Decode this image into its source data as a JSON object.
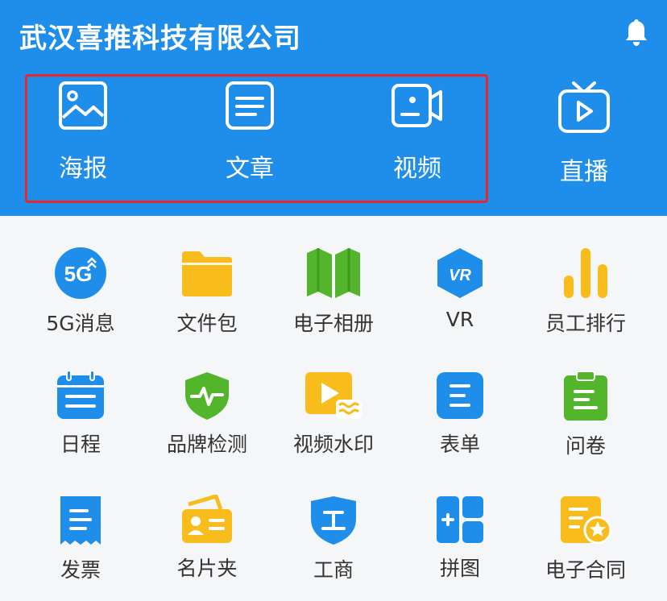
{
  "header": {
    "title": "武汉喜推科技有限公司"
  },
  "quick": [
    {
      "label": "海报",
      "icon": "image-icon"
    },
    {
      "label": "文章",
      "icon": "article-icon"
    },
    {
      "label": "视频",
      "icon": "video-camera-icon"
    },
    {
      "label": "直播",
      "icon": "tv-play-icon"
    }
  ],
  "grid": [
    {
      "label": "5G消息",
      "icon": "5g-icon",
      "color": "#1e8eea"
    },
    {
      "label": "文件包",
      "icon": "folder-icon",
      "color": "#f8bd1c"
    },
    {
      "label": "电子相册",
      "icon": "book-icon",
      "color": "#52b52b"
    },
    {
      "label": "VR",
      "icon": "vr-icon",
      "color": "#1e8eea"
    },
    {
      "label": "员工排行",
      "icon": "bar-chart-icon",
      "color": "#f8bd1c"
    },
    {
      "label": "日程",
      "icon": "calendar-icon",
      "color": "#1e8eea"
    },
    {
      "label": "品牌检测",
      "icon": "shield-pulse-icon",
      "color": "#52b52b"
    },
    {
      "label": "视频水印",
      "icon": "video-watermark-icon",
      "color": "#f8bd1c"
    },
    {
      "label": "表单",
      "icon": "form-icon",
      "color": "#1e8eea"
    },
    {
      "label": "问卷",
      "icon": "clipboard-icon",
      "color": "#52b52b"
    },
    {
      "label": "发票",
      "icon": "receipt-icon",
      "color": "#1e8eea"
    },
    {
      "label": "名片夹",
      "icon": "business-card-icon",
      "color": "#f8bd1c"
    },
    {
      "label": "工商",
      "icon": "commerce-shield-icon",
      "color": "#1e8eea"
    },
    {
      "label": "拼图",
      "icon": "puzzle-grid-icon",
      "color": "#1e8eea"
    },
    {
      "label": "电子合同",
      "icon": "contract-icon",
      "color": "#f8bd1c"
    }
  ]
}
